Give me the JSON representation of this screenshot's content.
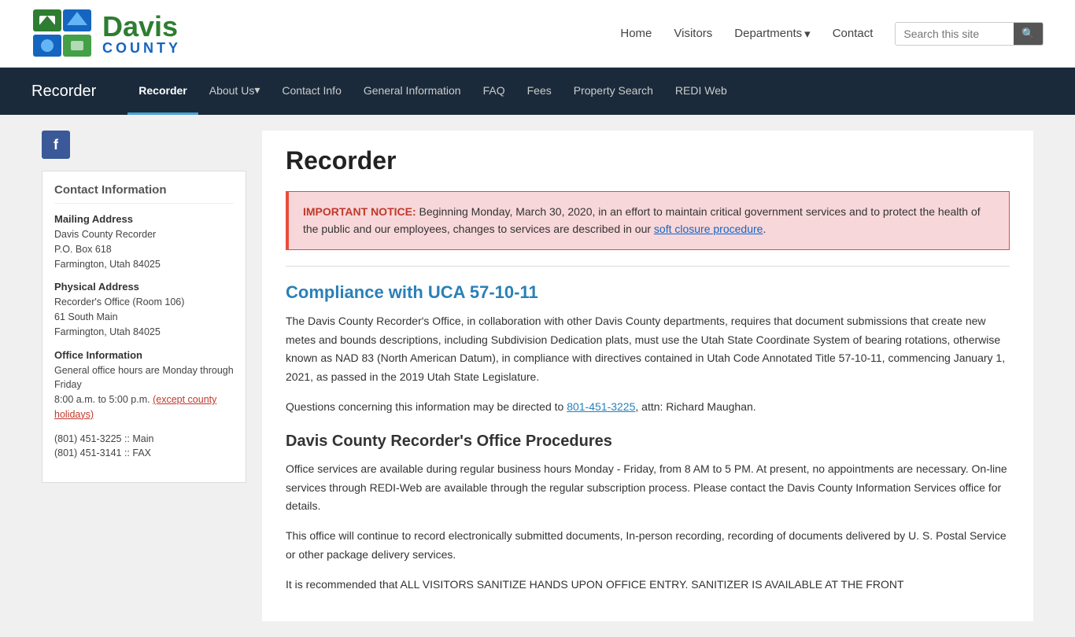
{
  "site": {
    "title": "Davis County",
    "logo_davis": "Davis",
    "logo_county": "COUNTY"
  },
  "top_header": {
    "nav": {
      "home": "Home",
      "visitors": "Visitors",
      "departments": "Departments",
      "contact": "Contact"
    },
    "search_placeholder": "Search this site",
    "search_button_icon": "🔍"
  },
  "dark_nav": {
    "section_title": "Recorder",
    "links": [
      {
        "label": "Recorder",
        "active": true
      },
      {
        "label": "About Us",
        "active": false
      },
      {
        "label": "Contact Info",
        "active": false
      },
      {
        "label": "General Information",
        "active": false
      },
      {
        "label": "FAQ",
        "active": false
      },
      {
        "label": "Fees",
        "active": false
      },
      {
        "label": "Property Search",
        "active": false
      },
      {
        "label": "REDI Web",
        "active": false
      }
    ]
  },
  "sidebar": {
    "facebook_label": "f",
    "contact_box_title": "Contact Information",
    "mailing_heading": "Mailing Address",
    "mailing_name": "Davis County Recorder",
    "mailing_po": "P.O. Box 618",
    "mailing_city": "Farmington, Utah 84025",
    "physical_heading": "Physical Address",
    "physical_room": "Recorder's Office (Room 106)",
    "physical_street": "61 South Main",
    "physical_city": "Farmington, Utah 84025",
    "office_heading": "Office Information",
    "office_hours": "General office hours are Monday through Friday",
    "office_time": "8:00 a.m. to 5:00 p.m.",
    "office_except": "(except county holidays)",
    "phone_main": "(801) 451-3225 :: Main",
    "phone_fax": "(801) 451-3141 :: FAX"
  },
  "content": {
    "page_title": "Recorder",
    "notice_label": "IMPORTANT NOTICE:",
    "notice_text": " Beginning Monday, March 30, 2020, in an effort to maintain critical government services and to protect the health of the public and our employees, changes to services are described in our ",
    "notice_link_text": "soft closure procedure",
    "notice_end": ".",
    "section1_title": "Compliance with UCA 57-10-11",
    "section1_para1": "The Davis County Recorder's Office, in collaboration with other Davis County departments, requires that document submissions that create new metes and bounds descriptions, including Subdivision Dedication plats, must use the Utah State Coordinate System of bearing rotations, otherwise known as NAD 83  (North American Datum), in compliance with directives contained in Utah Code Annotated Title 57-10-11, commencing January 1, 2021, as passed in the 2019 Utah State Legislature.",
    "section1_para2_pre": "Questions concerning this information may be directed to ",
    "section1_phone_link": "801-451-3225",
    "section1_para2_post": ", attn:  Richard Maughan.",
    "section2_title": "Davis County Recorder's Office Procedures",
    "section2_para1": "Office services are available during regular business hours Monday - Friday, from 8 AM to 5 PM.   At present, no appointments are necessary.  On-line services through REDI-Web are available through the regular subscription process.  Please contact the Davis County Information Services office for details.",
    "section2_para2": "This office will continue to record electronically submitted documents, In-person recording, recording of documents delivered by U. S. Postal Service or other package delivery  services.",
    "section2_para3": "It is recommended that ALL VISITORS SANITIZE HANDS UPON OFFICE ENTRY. SANITIZER IS AVAILABLE AT THE FRONT"
  }
}
